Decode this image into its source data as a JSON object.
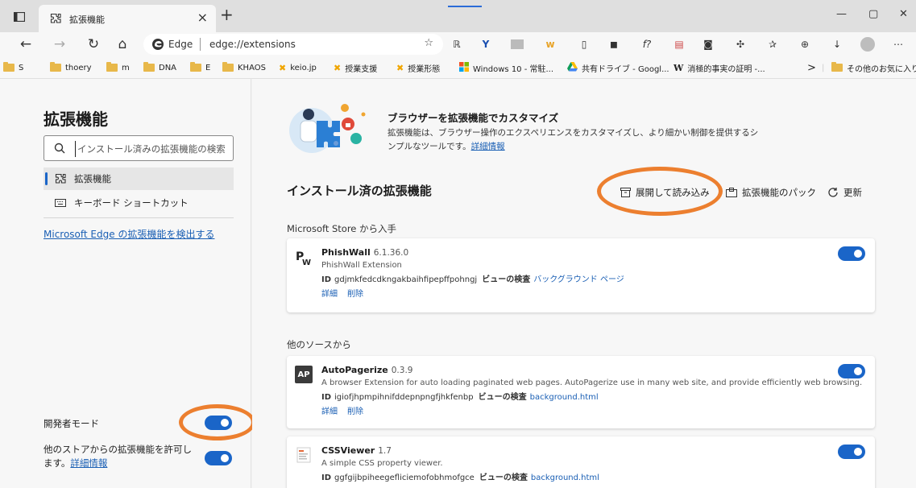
{
  "tab": {
    "title": "拡張機能",
    "close": "×",
    "new": "+"
  },
  "window": {
    "minimize": "—",
    "maximize": "▢",
    "close": "✕"
  },
  "nav": {
    "back": "←",
    "forward": "→",
    "refresh": "↻",
    "home": "⌂"
  },
  "omnibox": {
    "label": "Edge",
    "url": "edge://extensions",
    "favorite": "☆"
  },
  "bookmarks": [
    {
      "label": "S",
      "kind": "folder"
    },
    {
      "label": "thoery",
      "kind": "folder"
    },
    {
      "label": "m",
      "kind": "folder"
    },
    {
      "label": "DNA",
      "kind": "folder"
    },
    {
      "label": "E",
      "kind": "folder"
    },
    {
      "label": "KHAOS",
      "kind": "folder"
    },
    {
      "label": "keio.jp",
      "kind": "site"
    },
    {
      "label": "授業支援",
      "kind": "site"
    },
    {
      "label": "授業形態",
      "kind": "site"
    },
    {
      "label": "Windows 10 - 常駐...",
      "kind": "site"
    },
    {
      "label": "共有ドライブ - Googl...",
      "kind": "site"
    },
    {
      "label": "消極的事実の証明 -...",
      "kind": "site"
    },
    {
      "label": "その他のお気に入り",
      "kind": "folder"
    }
  ],
  "bookmarks_overflow": ">",
  "sidebar": {
    "title": "拡張機能",
    "search_placeholder": "インストール済みの拡張機能の検索",
    "items": [
      {
        "label": "拡張機能",
        "active": true
      },
      {
        "label": "キーボード ショートカット",
        "active": false
      }
    ],
    "discover_link": "Microsoft Edge の拡張機能を検出する",
    "dev_mode_label": "開発者モード",
    "allow_stores_label": "他のストアからの拡張機能を許可します。",
    "allow_stores_link": "詳細情報",
    "dev_mode_on": true,
    "allow_stores_on": true
  },
  "hero": {
    "title": "ブラウザーを拡張機能でカスタマイズ",
    "desc": "拡張機能は、ブラウザー操作のエクスペリエンスをカスタマイズし、より細かい制御を提供するシンプルなツールです。",
    "link": "詳細情報"
  },
  "installed": {
    "title": "インストール済の拡張機能",
    "load_unpacked": "展開して読み込み",
    "pack": "拡張機能のパック",
    "update": "更新"
  },
  "sections": {
    "store": "Microsoft Store から入手",
    "other": "他のソースから"
  },
  "labels": {
    "id": "ID",
    "inspect": "ビューの検査",
    "details": "詳細",
    "remove": "削除"
  },
  "extensions": [
    {
      "name": "PhishWall",
      "version": "6.1.36.0",
      "description": "PhishWall Extension",
      "id": "gdjmkfedcdkngakbaihfipepffpohngj",
      "inspect_link": "バックグラウンド ページ",
      "enabled": true
    },
    {
      "name": "AutoPagerize",
      "version": "0.3.9",
      "description": "A browser Extension for auto loading paginated web pages. AutoPagerize use in many web site, and provide efficiently web browsing.",
      "id": "igiofjhpmpihnifddepnpngfjhkfenbp",
      "inspect_link": "background.html",
      "enabled": true
    },
    {
      "name": "CSSViewer",
      "version": "1.7",
      "description": "A simple CSS property viewer.",
      "id": "ggfgijbpiheegefliciemofobhmofgce",
      "inspect_link": "background.html",
      "enabled": true
    }
  ],
  "colors": {
    "accent": "#1a65c8",
    "link": "#1a5fb4",
    "highlight_ring": "#ec7f2f",
    "folder": "#e8b84a"
  }
}
